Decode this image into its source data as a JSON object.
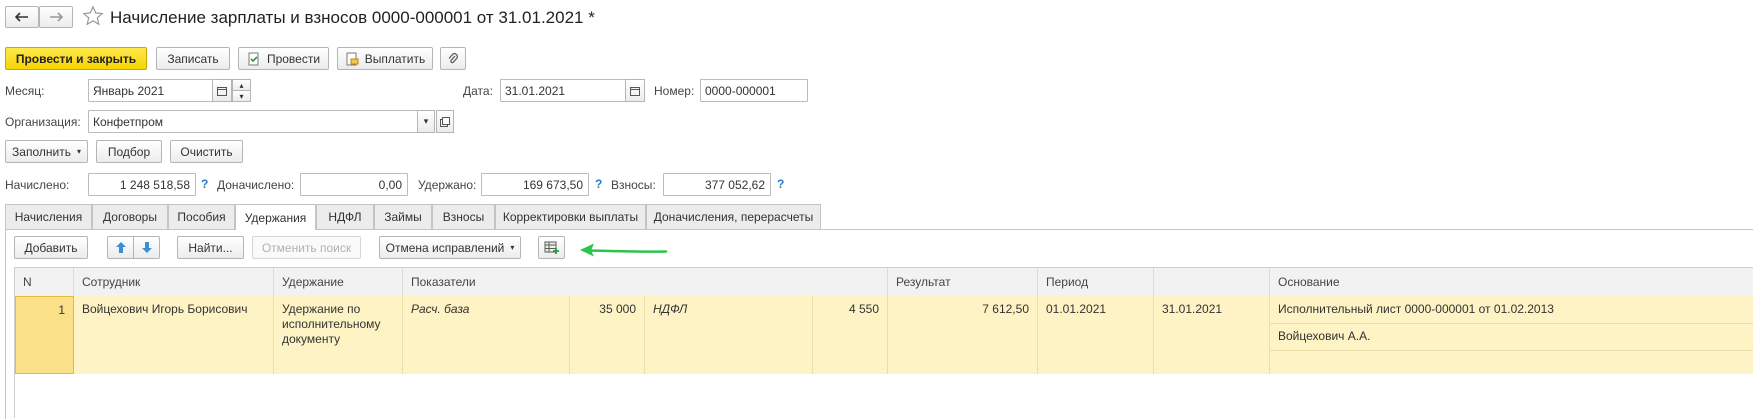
{
  "window": {
    "title": "Начисление зарплаты и взносов 0000-000001 от 31.01.2021 *"
  },
  "toolbar": {
    "post_close": "Провести и закрыть",
    "save": "Записать",
    "post": "Провести",
    "pay": "Выплатить"
  },
  "form": {
    "month_label": "Месяц:",
    "month_value": "Январь 2021",
    "date_label": "Дата:",
    "date_value": "31.01.2021",
    "number_label": "Номер:",
    "number_value": "0000-000001",
    "org_label": "Организация:",
    "org_value": "Конфетпром",
    "fill": "Заполнить",
    "pick": "Подбор",
    "clear": "Очистить",
    "accrued_label": "Начислено:",
    "accrued_value": "1 248 518,58",
    "extra_label": "Доначислено:",
    "extra_value": "0,00",
    "withheld_label": "Удержано:",
    "withheld_value": "169 673,50",
    "contrib_label": "Взносы:",
    "contrib_value": "377 052,62",
    "help": "?"
  },
  "tabs": [
    "Начисления",
    "Договоры",
    "Пособия",
    "Удержания",
    "НДФЛ",
    "Займы",
    "Взносы",
    "Корректировки выплаты",
    "Доначисления, перерасчеты"
  ],
  "tab_toolbar": {
    "add": "Добавить",
    "find": "Найти...",
    "cancel_search": "Отменить поиск",
    "cancel_fix": "Отмена исправлений"
  },
  "table": {
    "headers": {
      "n": "N",
      "employee": "Сотрудник",
      "deduction": "Удержание",
      "indicators": "Показатели",
      "result": "Результат",
      "period": "Период",
      "basis": "Основание"
    },
    "row": {
      "n": "1",
      "employee": "Войцехович Игорь Борисович",
      "deduction": "Удержание по исполнительному документу",
      "ind1_name": "Расч. база",
      "ind1_value": "35 000",
      "ind2_name": "НДФЛ",
      "ind2_value": "4 550",
      "result": "7 612,50",
      "period_from": "01.01.2021",
      "period_to": "31.01.2021",
      "basis_line1": "Исполнительный лист 0000-000001 от 01.02.2013",
      "basis_line2": "Войцехович А.А."
    }
  },
  "colors": {
    "primary": "#f6d300",
    "row_highlight": "#fdf3c5",
    "arrow": "#2bc44a",
    "help": "#2a7ac8"
  }
}
